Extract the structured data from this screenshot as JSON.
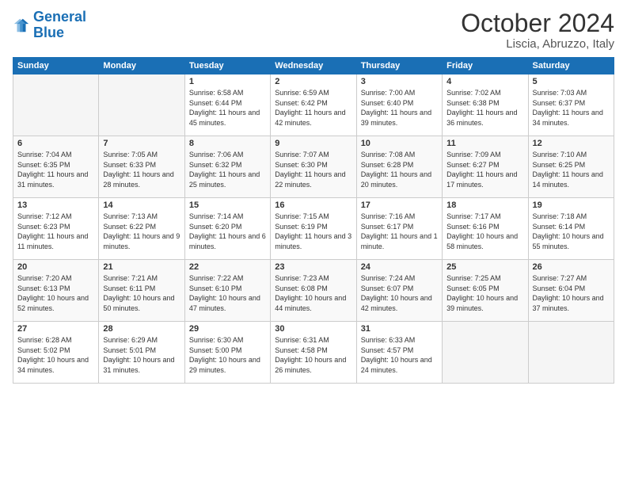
{
  "logo": {
    "line1": "General",
    "line2": "Blue"
  },
  "title": "October 2024",
  "location": "Liscia, Abruzzo, Italy",
  "days_of_week": [
    "Sunday",
    "Monday",
    "Tuesday",
    "Wednesday",
    "Thursday",
    "Friday",
    "Saturday"
  ],
  "weeks": [
    [
      {
        "day": "",
        "info": ""
      },
      {
        "day": "",
        "info": ""
      },
      {
        "day": "1",
        "info": "Sunrise: 6:58 AM\nSunset: 6:44 PM\nDaylight: 11 hours and 45 minutes."
      },
      {
        "day": "2",
        "info": "Sunrise: 6:59 AM\nSunset: 6:42 PM\nDaylight: 11 hours and 42 minutes."
      },
      {
        "day": "3",
        "info": "Sunrise: 7:00 AM\nSunset: 6:40 PM\nDaylight: 11 hours and 39 minutes."
      },
      {
        "day": "4",
        "info": "Sunrise: 7:02 AM\nSunset: 6:38 PM\nDaylight: 11 hours and 36 minutes."
      },
      {
        "day": "5",
        "info": "Sunrise: 7:03 AM\nSunset: 6:37 PM\nDaylight: 11 hours and 34 minutes."
      }
    ],
    [
      {
        "day": "6",
        "info": "Sunrise: 7:04 AM\nSunset: 6:35 PM\nDaylight: 11 hours and 31 minutes."
      },
      {
        "day": "7",
        "info": "Sunrise: 7:05 AM\nSunset: 6:33 PM\nDaylight: 11 hours and 28 minutes."
      },
      {
        "day": "8",
        "info": "Sunrise: 7:06 AM\nSunset: 6:32 PM\nDaylight: 11 hours and 25 minutes."
      },
      {
        "day": "9",
        "info": "Sunrise: 7:07 AM\nSunset: 6:30 PM\nDaylight: 11 hours and 22 minutes."
      },
      {
        "day": "10",
        "info": "Sunrise: 7:08 AM\nSunset: 6:28 PM\nDaylight: 11 hours and 20 minutes."
      },
      {
        "day": "11",
        "info": "Sunrise: 7:09 AM\nSunset: 6:27 PM\nDaylight: 11 hours and 17 minutes."
      },
      {
        "day": "12",
        "info": "Sunrise: 7:10 AM\nSunset: 6:25 PM\nDaylight: 11 hours and 14 minutes."
      }
    ],
    [
      {
        "day": "13",
        "info": "Sunrise: 7:12 AM\nSunset: 6:23 PM\nDaylight: 11 hours and 11 minutes."
      },
      {
        "day": "14",
        "info": "Sunrise: 7:13 AM\nSunset: 6:22 PM\nDaylight: 11 hours and 9 minutes."
      },
      {
        "day": "15",
        "info": "Sunrise: 7:14 AM\nSunset: 6:20 PM\nDaylight: 11 hours and 6 minutes."
      },
      {
        "day": "16",
        "info": "Sunrise: 7:15 AM\nSunset: 6:19 PM\nDaylight: 11 hours and 3 minutes."
      },
      {
        "day": "17",
        "info": "Sunrise: 7:16 AM\nSunset: 6:17 PM\nDaylight: 11 hours and 1 minute."
      },
      {
        "day": "18",
        "info": "Sunrise: 7:17 AM\nSunset: 6:16 PM\nDaylight: 10 hours and 58 minutes."
      },
      {
        "day": "19",
        "info": "Sunrise: 7:18 AM\nSunset: 6:14 PM\nDaylight: 10 hours and 55 minutes."
      }
    ],
    [
      {
        "day": "20",
        "info": "Sunrise: 7:20 AM\nSunset: 6:13 PM\nDaylight: 10 hours and 52 minutes."
      },
      {
        "day": "21",
        "info": "Sunrise: 7:21 AM\nSunset: 6:11 PM\nDaylight: 10 hours and 50 minutes."
      },
      {
        "day": "22",
        "info": "Sunrise: 7:22 AM\nSunset: 6:10 PM\nDaylight: 10 hours and 47 minutes."
      },
      {
        "day": "23",
        "info": "Sunrise: 7:23 AM\nSunset: 6:08 PM\nDaylight: 10 hours and 44 minutes."
      },
      {
        "day": "24",
        "info": "Sunrise: 7:24 AM\nSunset: 6:07 PM\nDaylight: 10 hours and 42 minutes."
      },
      {
        "day": "25",
        "info": "Sunrise: 7:25 AM\nSunset: 6:05 PM\nDaylight: 10 hours and 39 minutes."
      },
      {
        "day": "26",
        "info": "Sunrise: 7:27 AM\nSunset: 6:04 PM\nDaylight: 10 hours and 37 minutes."
      }
    ],
    [
      {
        "day": "27",
        "info": "Sunrise: 6:28 AM\nSunset: 5:02 PM\nDaylight: 10 hours and 34 minutes."
      },
      {
        "day": "28",
        "info": "Sunrise: 6:29 AM\nSunset: 5:01 PM\nDaylight: 10 hours and 31 minutes."
      },
      {
        "day": "29",
        "info": "Sunrise: 6:30 AM\nSunset: 5:00 PM\nDaylight: 10 hours and 29 minutes."
      },
      {
        "day": "30",
        "info": "Sunrise: 6:31 AM\nSunset: 4:58 PM\nDaylight: 10 hours and 26 minutes."
      },
      {
        "day": "31",
        "info": "Sunrise: 6:33 AM\nSunset: 4:57 PM\nDaylight: 10 hours and 24 minutes."
      },
      {
        "day": "",
        "info": ""
      },
      {
        "day": "",
        "info": ""
      }
    ]
  ]
}
